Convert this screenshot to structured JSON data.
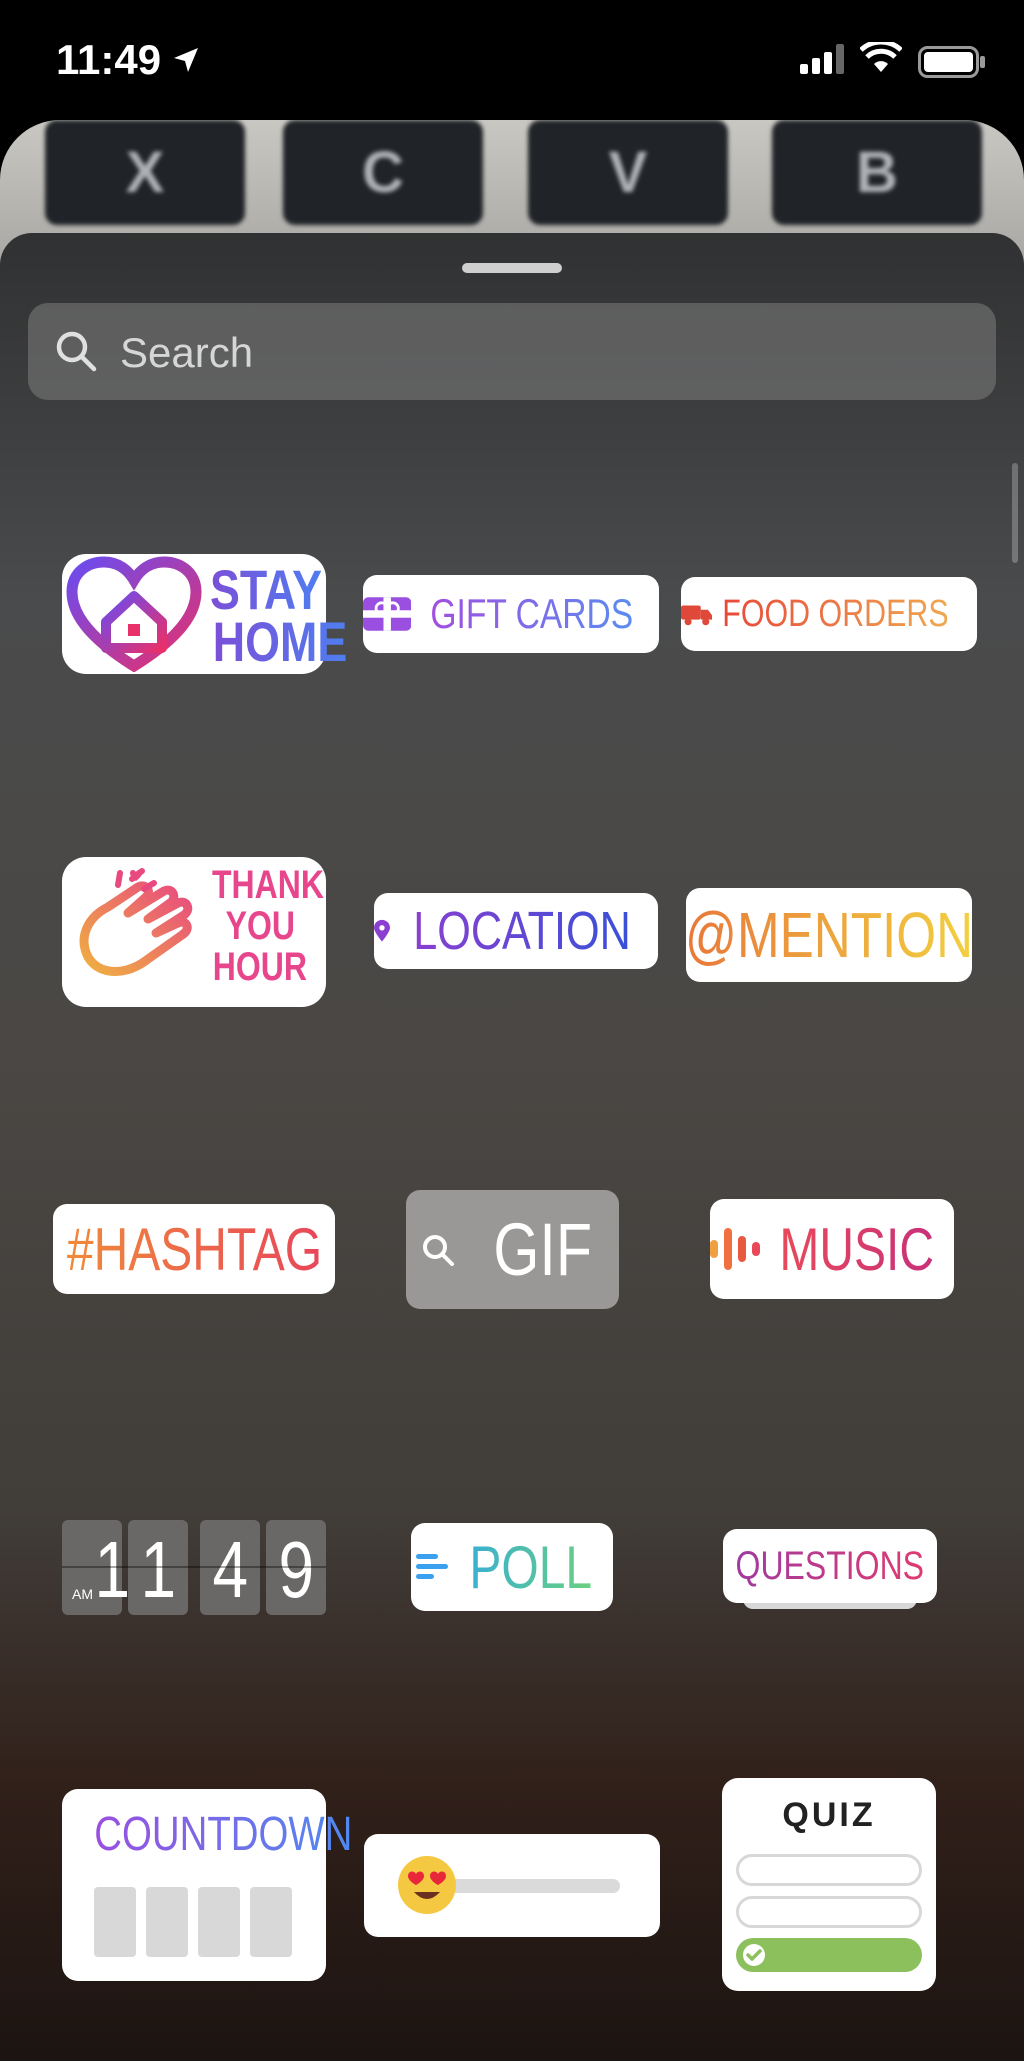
{
  "status_bar": {
    "time": "11:49"
  },
  "keyboard_keys": [
    "X",
    "C",
    "V",
    "B"
  ],
  "search": {
    "placeholder": "Search"
  },
  "stickers": {
    "stay_home": {
      "line1": "STAY",
      "line2": "HOME"
    },
    "gift_cards": "GIFT CARDS",
    "food_orders": "FOOD ORDERS",
    "thank_you": {
      "line1": "THANK",
      "line2": "YOU",
      "line3": "HOUR"
    },
    "location": "LOCATION",
    "mention": "@MENTION",
    "hashtag": "#HASHTAG",
    "gif": "GIF",
    "music": "MUSIC",
    "clock": {
      "ampm": "AM",
      "digits": [
        "1",
        "1",
        "4",
        "9"
      ]
    },
    "poll": "POLL",
    "questions": "QUESTIONS",
    "countdown": "COUNTDOWN",
    "quiz": "QUIZ"
  },
  "colors": {
    "sheet_top": "#303132",
    "sheet_bottom": "#1c1411",
    "quiz_correct": "#8cc05c"
  }
}
